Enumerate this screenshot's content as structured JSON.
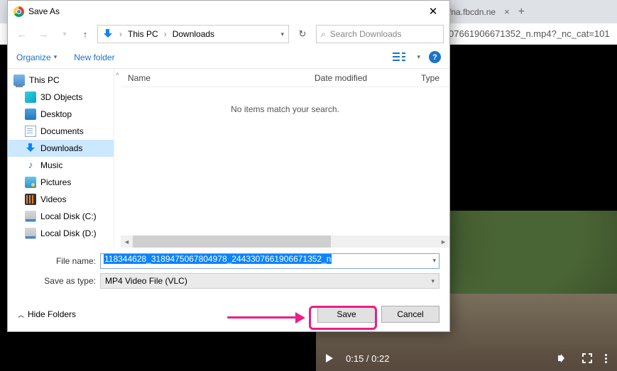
{
  "browser": {
    "tab_label": "fna.fbcdn.ne",
    "url_fragment": "07661906671352_n.mp4?_nc_cat=101"
  },
  "dialog": {
    "title": "Save As",
    "breadcrumb": {
      "pc": "This PC",
      "loc": "Downloads"
    },
    "search_placeholder": "Search Downloads",
    "toolbar": {
      "organize": "Organize",
      "new_folder": "New folder"
    },
    "tree": {
      "root": "This PC",
      "items": [
        "3D Objects",
        "Desktop",
        "Documents",
        "Downloads",
        "Music",
        "Pictures",
        "Videos",
        "Local Disk (C:)",
        "Local Disk (D:)"
      ]
    },
    "columns": {
      "name": "Name",
      "date": "Date modified",
      "type": "Type"
    },
    "empty_msg": "No items match your search.",
    "filename_label": "File name:",
    "filename_value": "118344628_3189475067804978_2443307661906671352_n",
    "type_label": "Save as type:",
    "type_value": "MP4 Video File (VLC)",
    "hide_folders": "Hide Folders",
    "save": "Save",
    "cancel": "Cancel"
  },
  "video": {
    "time": "0:15 / 0:22"
  }
}
